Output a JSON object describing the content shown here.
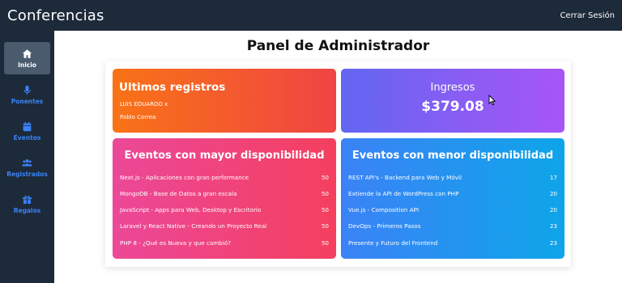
{
  "header": {
    "app_title": "Conferencias",
    "logout_label": "Cerrar Sesión"
  },
  "sidebar": {
    "items": [
      {
        "label": "Inicio",
        "icon": "home-icon",
        "active": true
      },
      {
        "label": "Ponentes",
        "icon": "microphone-icon",
        "active": false
      },
      {
        "label": "Eventos",
        "icon": "calendar-icon",
        "active": false
      },
      {
        "label": "Registrados",
        "icon": "users-icon",
        "active": false
      },
      {
        "label": "Regalos",
        "icon": "gift-icon",
        "active": false
      }
    ]
  },
  "main": {
    "title": "Panel de Administrador",
    "recent": {
      "title": "Ultimos registros",
      "entries": [
        "LUIS EDUARDO x",
        "Pablo Correa"
      ]
    },
    "income": {
      "title": "Ingresos",
      "amount": "$379.08"
    },
    "most_available": {
      "title": "Eventos con mayor disponibilidad",
      "events": [
        {
          "name": "Next.js - Aplicaciones con gran performance",
          "count": "50"
        },
        {
          "name": "MongoDB - Base de Datos a gran escala",
          "count": "50"
        },
        {
          "name": "JavaScript - Apps para Web, Desktop y Escritorio",
          "count": "50"
        },
        {
          "name": "Laravel y React Native - Creando un Proyecto Real",
          "count": "50"
        },
        {
          "name": "PHP 8 - ¿Qué es Nueva y que cambió?",
          "count": "50"
        }
      ]
    },
    "least_available": {
      "title": "Eventos con menor disponibilidad",
      "events": [
        {
          "name": "REST API's - Backend para Web y Móvil",
          "count": "17"
        },
        {
          "name": "Extiende la API de WordPress con PHP",
          "count": "20"
        },
        {
          "name": "Vue.js - Composition API",
          "count": "20"
        },
        {
          "name": "DevOps - Primeros Pasos",
          "count": "23"
        },
        {
          "name": "Presente y Futuro del Frontend",
          "count": "23"
        }
      ]
    }
  },
  "colors": {
    "topbar": "#1d2a3a",
    "nav_text": "#3b82f6",
    "card_recent": [
      "#f97316",
      "#ef4444"
    ],
    "card_income": [
      "#6366f1",
      "#a855f7"
    ],
    "card_most": [
      "#ec4899",
      "#f43f5e"
    ],
    "card_least": [
      "#3b82f6",
      "#0ea5e9"
    ]
  }
}
